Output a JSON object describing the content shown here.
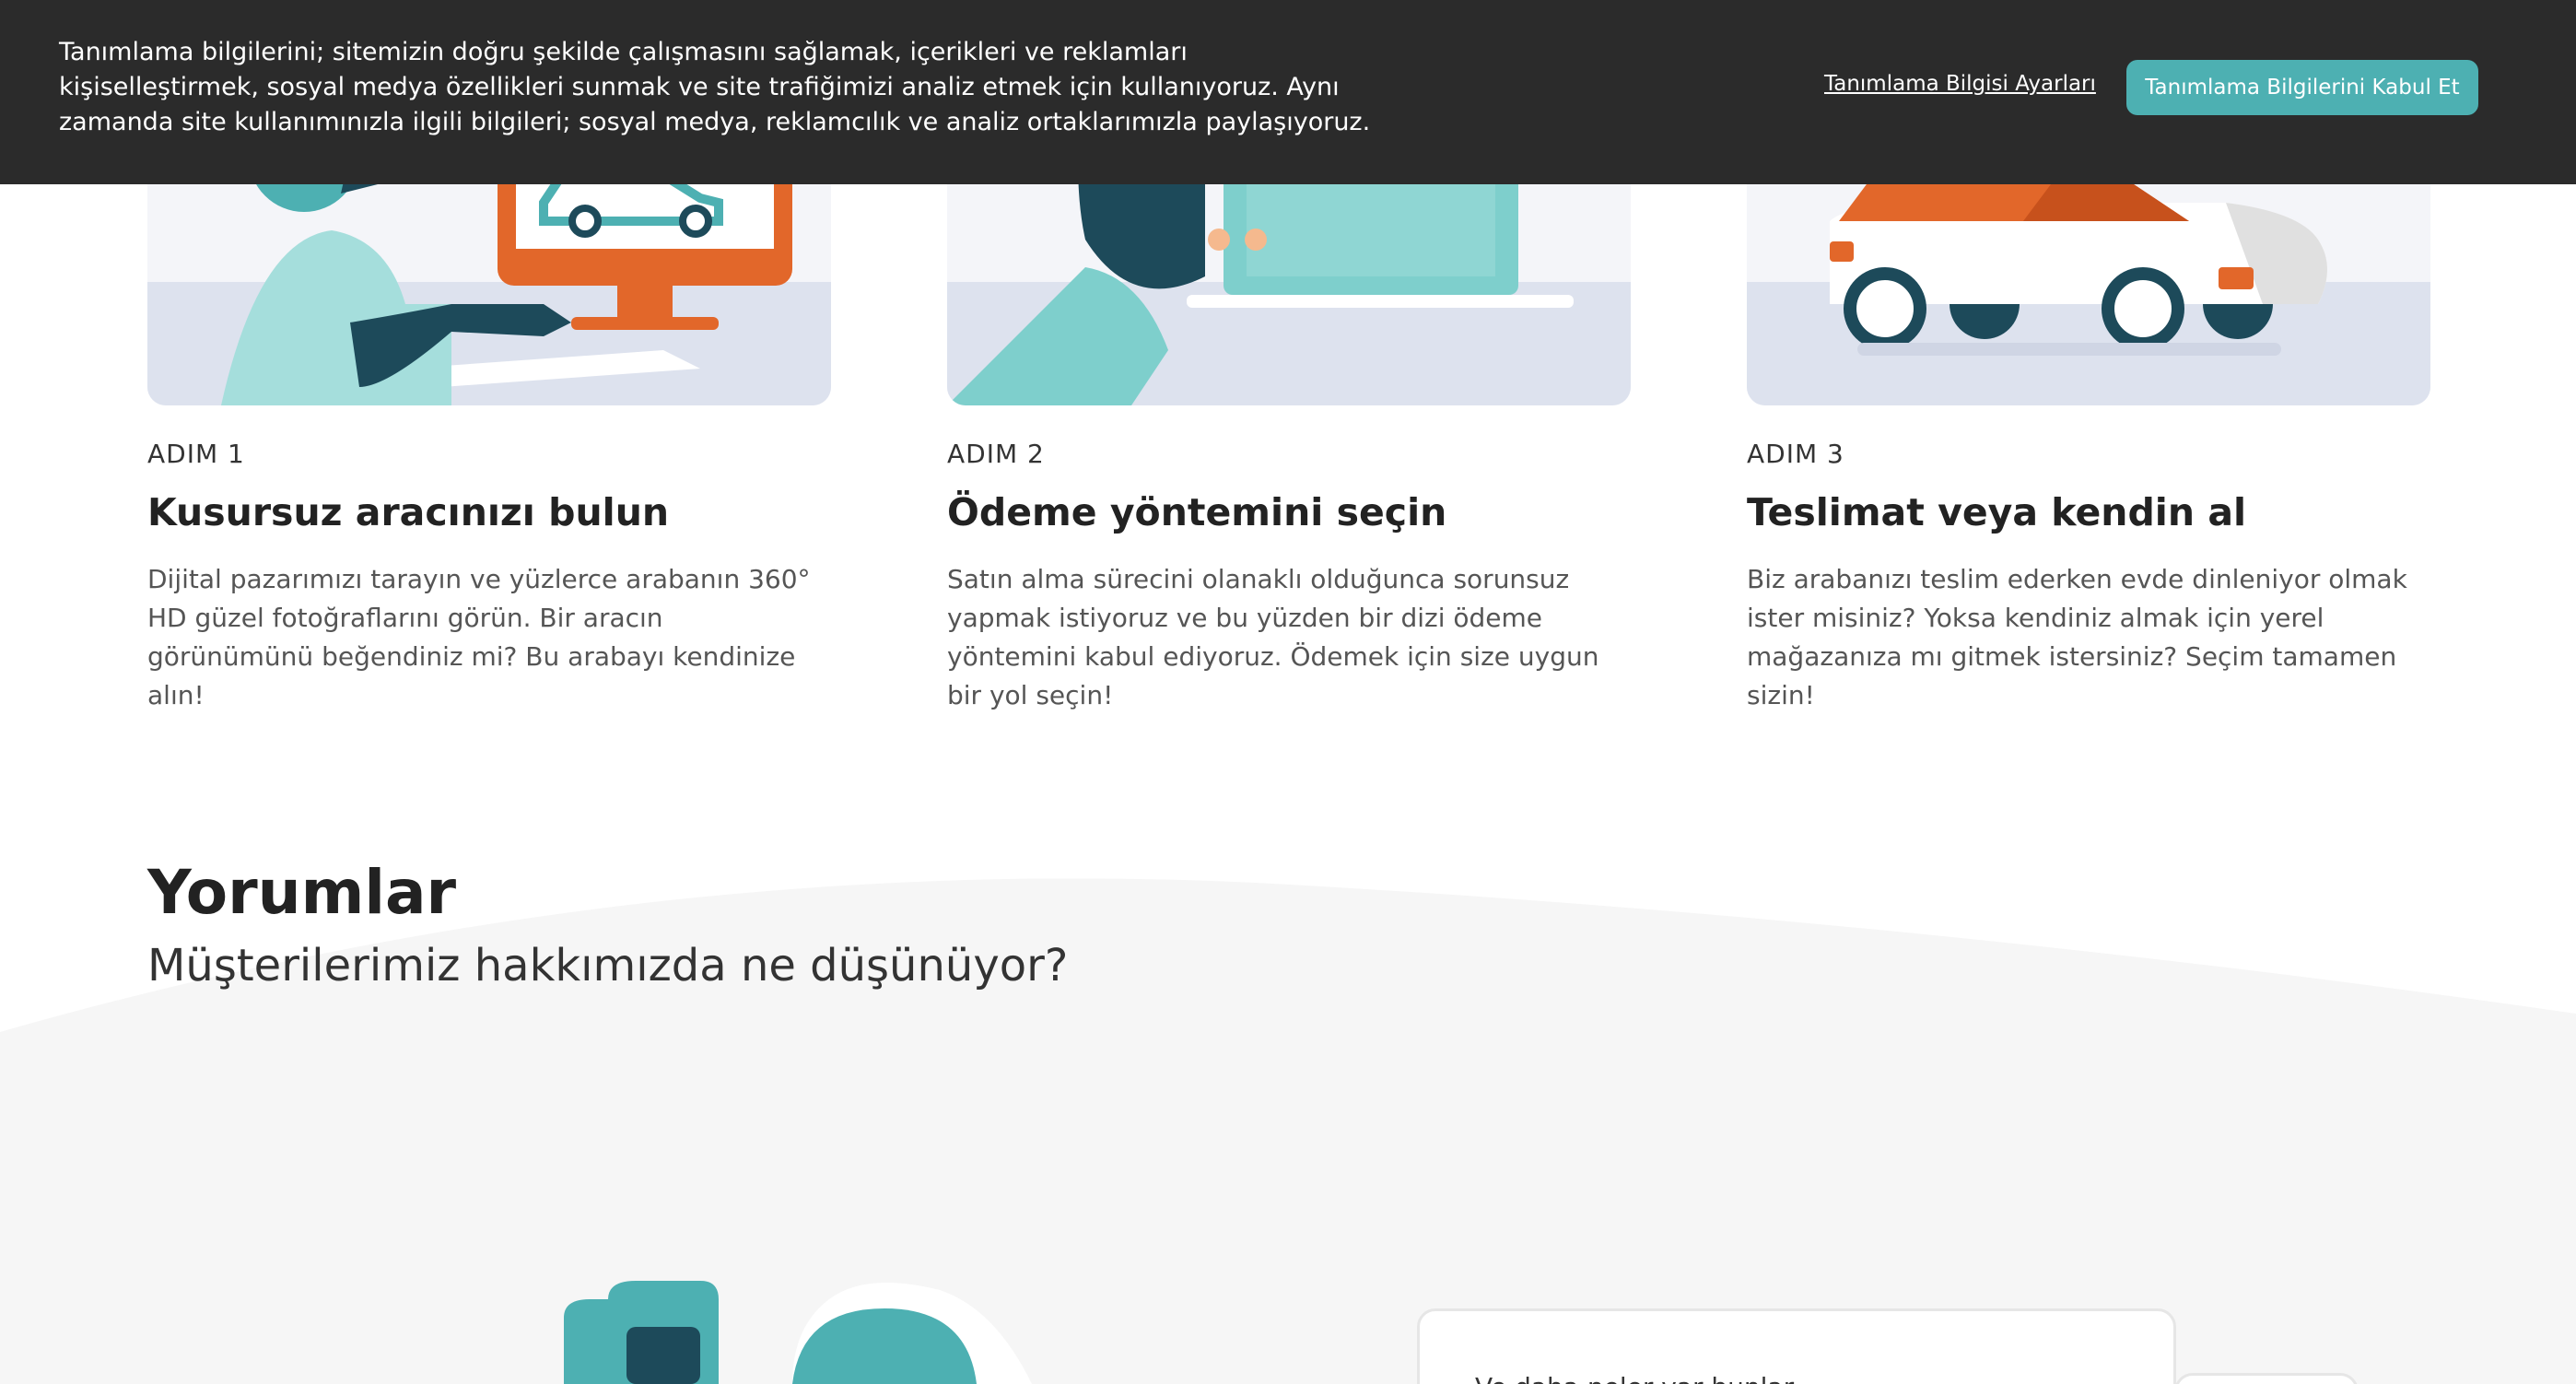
{
  "cookie": {
    "text": "Tanımlama bilgilerini; sitemizin doğru şekilde çalışmasını sağlamak, içerikleri ve reklamları kişiselleştirmek, sosyal medya özellikleri sunmak ve site trafiğimizi analiz etmek için kullanıyoruz. Aynı zamanda site kullanımınızla ilgili bilgileri; sosyal medya, reklamcılık ve analiz ortaklarımızla paylaşıyoruz.",
    "settings_label": "Tanımlama Bilgisi Ayarları",
    "accept_label": "Tanımlama Bilgilerini Kabul Et"
  },
  "steps": [
    {
      "label": "ADIM 1",
      "title": "Kusursuz aracınızı bulun",
      "description": "Dijital pazarımızı tarayın ve yüzlerce arabanın 360° HD güzel fotoğraflarını görün. Bir aracın görünümünü beğendiniz mi? Bu arabayı kendinize alın!",
      "icon": "computer-shopping-illustration"
    },
    {
      "label": "ADIM 2",
      "title": "Ödeme yöntemini seçin",
      "description": "Satın alma sürecini olanaklı olduğunca sorunsuz yapmak istiyoruz ve bu yüzden bir dizi ödeme yöntemini kabul ediyoruz. Ödemek için size uygun bir yol seçin!",
      "icon": "payment-card-illustration"
    },
    {
      "label": "ADIM 3",
      "title": "Teslimat veya kendin al",
      "description": "Biz arabanızı teslim ederken evde dinleniyor olmak ister misiniz? Yoksa kendiniz almak için yerel mağazanıza mı gitmek istersiniz? Seçim tamamen sizin!",
      "icon": "delivery-car-illustration"
    }
  ],
  "reviews": {
    "title": "Yorumlar",
    "subtitle": "Müşterilerimiz hakkımızda ne düşünüyor?",
    "card_text": "Ve daha neler var bunlar..."
  },
  "colors": {
    "teal": "#4db0b2",
    "dark_teal": "#1d4a5a",
    "orange": "#e2672a",
    "cookie_bg": "#2b2b2b"
  }
}
